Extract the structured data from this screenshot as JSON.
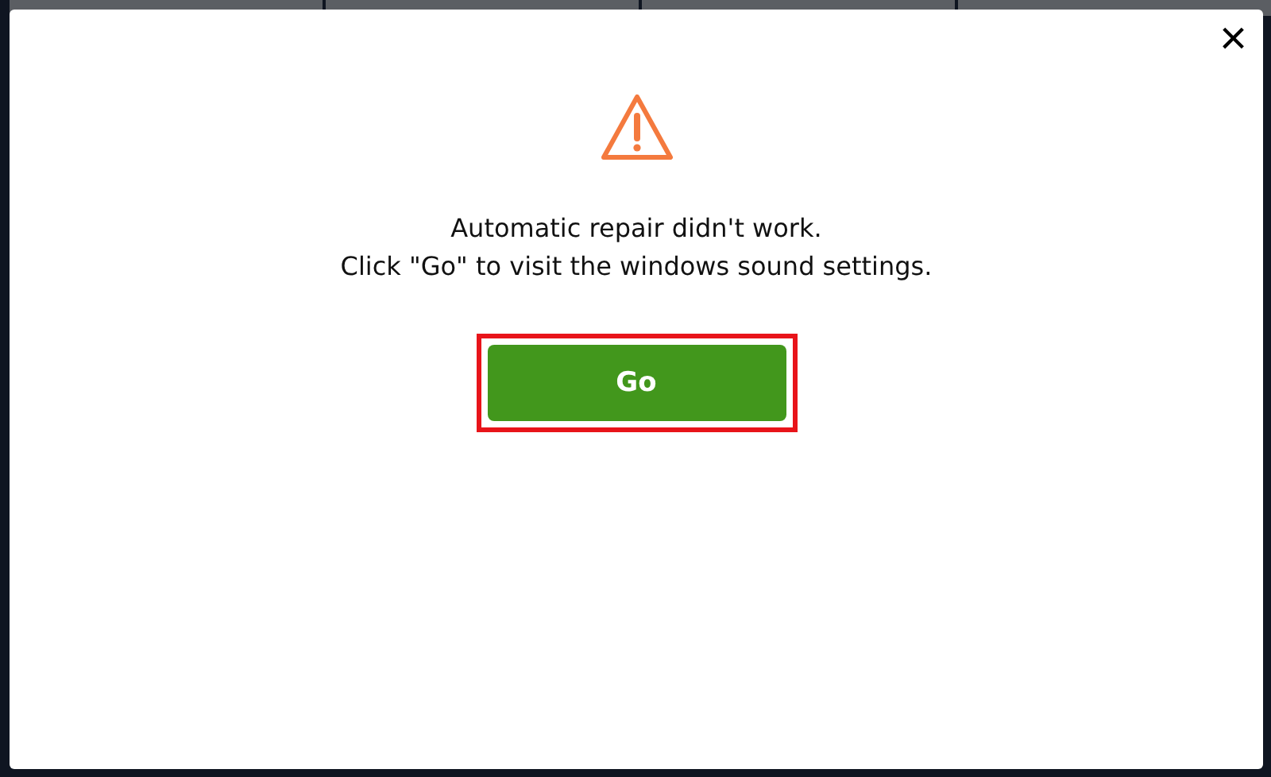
{
  "dialog": {
    "message_lines": [
      "Automatic repair didn't work.",
      "Click \"Go\" to visit the windows sound settings."
    ],
    "close_label": "×",
    "button": {
      "label": "Go",
      "highlighted": true
    }
  }
}
